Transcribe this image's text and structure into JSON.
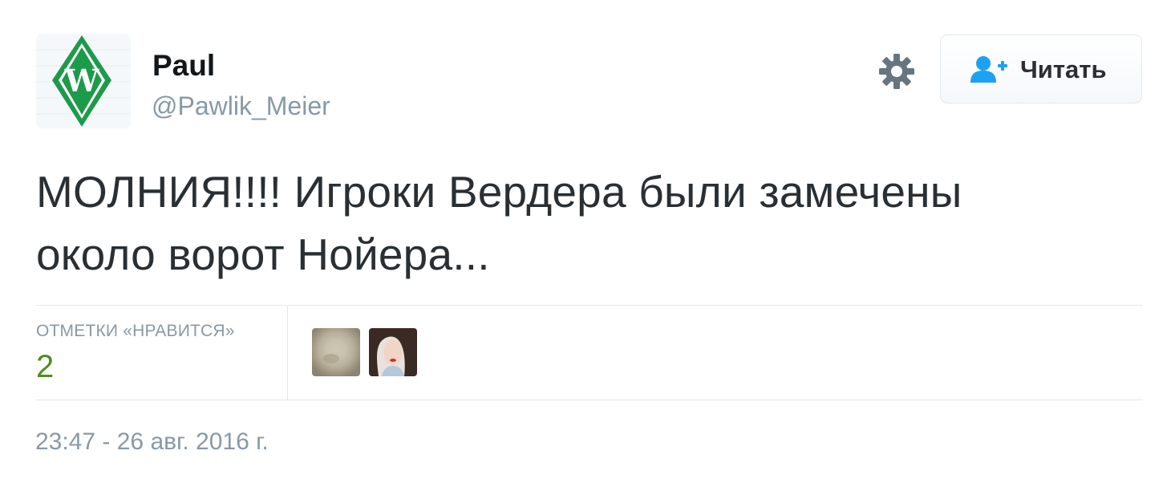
{
  "tweet": {
    "author": {
      "name": "Paul",
      "handle": "@Pawlik_Meier",
      "avatar_icon": "werder-bremen-logo",
      "avatar_colors": {
        "primary": "#1d9a4a",
        "background": "#f5f8fa"
      }
    },
    "actions": {
      "settings_icon": "gear-icon",
      "follow_label": "Читать",
      "follow_icon": "add-user-icon",
      "follow_icon_color": "#1da1f2"
    },
    "text_lines": [
      "МОЛНИЯ!!!! Игроки Вердера были замечены",
      "около ворот Нойера..."
    ],
    "stats": {
      "likes_label": "ОТМЕТКИ «НРАВИТСЯ»",
      "likes_count": "2",
      "likes_count_color": "#4e8e20",
      "likers": [
        {
          "name": "liker-avatar-1"
        },
        {
          "name": "liker-avatar-2"
        }
      ]
    },
    "timestamp": "23:47 - 26 авг. 2016 г."
  }
}
